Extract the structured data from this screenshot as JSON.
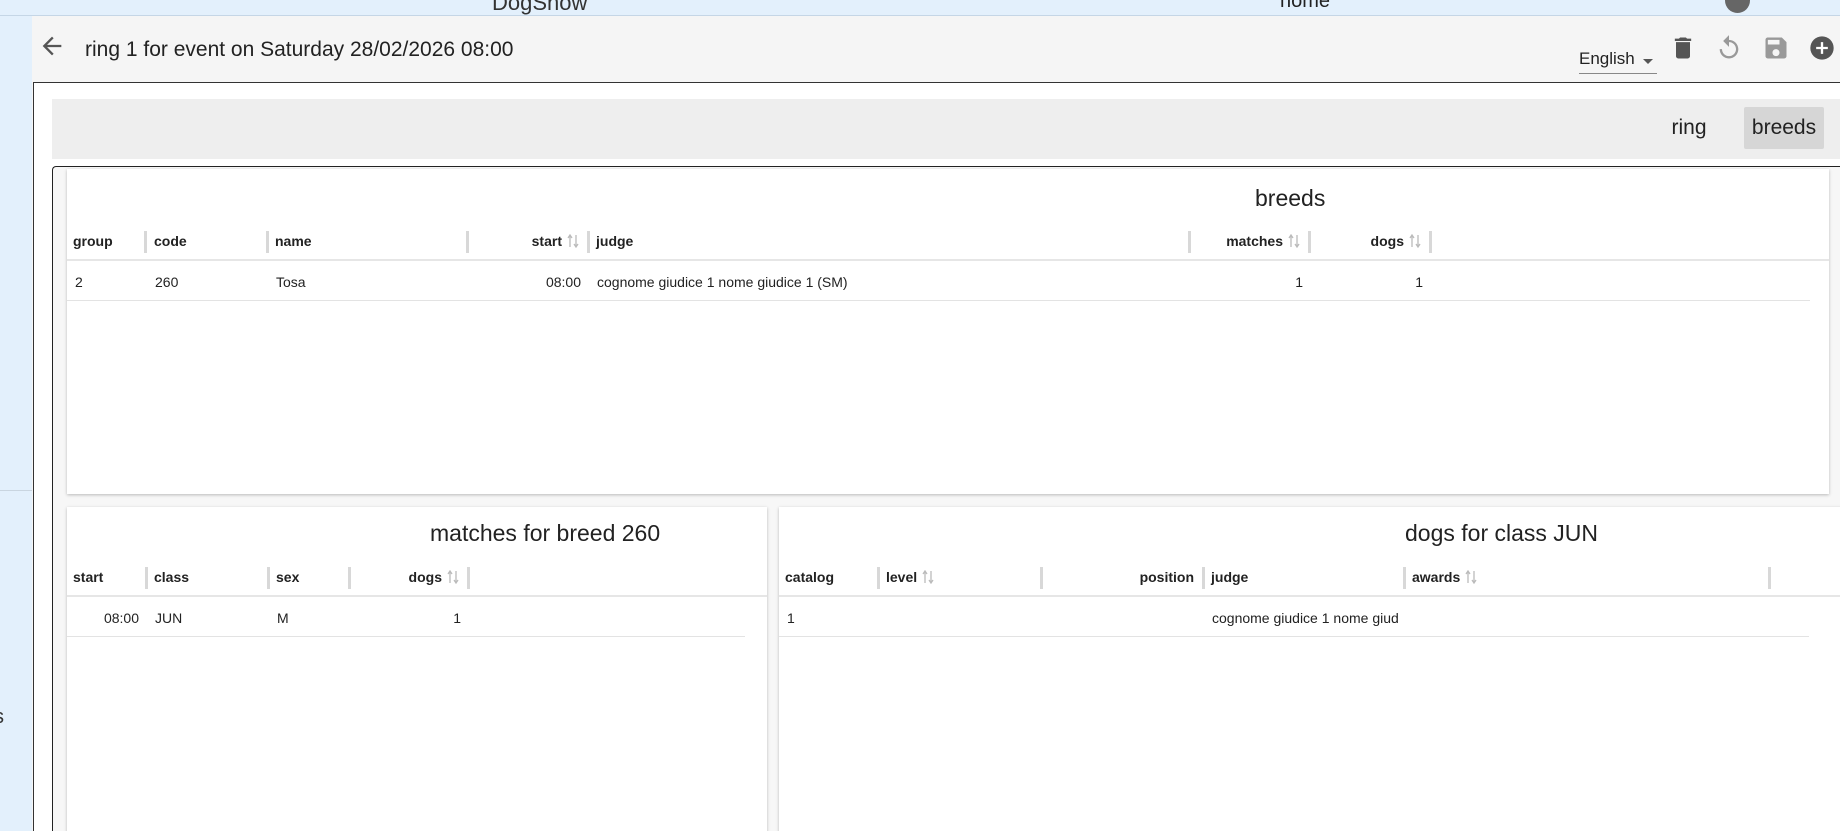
{
  "app": {
    "title": "DogShow",
    "nav_home": "home"
  },
  "header": {
    "title": "ring 1 for event on Saturday 28/02/2026 08:00",
    "language": "English"
  },
  "sidebar": {
    "fragment": "s"
  },
  "tabs": [
    {
      "label": "ring"
    },
    {
      "label": "breeds",
      "active": true
    }
  ],
  "breeds_table": {
    "title": "breeds",
    "columns": [
      "group",
      "code",
      "name",
      "start",
      "judge",
      "matches",
      "dogs"
    ],
    "rows": [
      {
        "group": "2",
        "code": "260",
        "name": "Tosa",
        "start": "08:00",
        "judge": "cognome giudice 1 nome giudice 1 (SM)",
        "matches": "1",
        "dogs": "1"
      }
    ]
  },
  "matches_table": {
    "title": "matches for breed 260",
    "columns": [
      "start",
      "class",
      "sex",
      "dogs"
    ],
    "rows": [
      {
        "start": "08:00",
        "class": "JUN",
        "sex": "M",
        "dogs": "1"
      }
    ]
  },
  "dogs_table": {
    "title": "dogs for class JUN",
    "columns": [
      "catalog",
      "level",
      "position",
      "judge",
      "awards"
    ],
    "rows": [
      {
        "catalog": "1",
        "level": "",
        "position": "",
        "judge": "cognome giudice 1 nome giud",
        "awards": ""
      }
    ]
  },
  "colors": {
    "sidebar_bg": "#e3f0fc",
    "active_tab": "#d6d6d6",
    "icon": "#555555"
  }
}
